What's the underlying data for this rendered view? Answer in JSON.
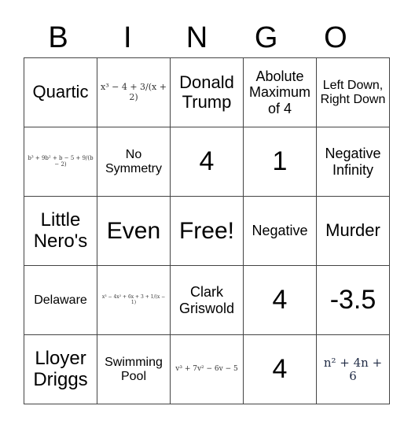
{
  "header": [
    "B",
    "I",
    "N",
    "G",
    "O"
  ],
  "cells": [
    [
      "Quartic",
      "x³ − 4 + 3/(x + 2)",
      "Donald Trump",
      "Abolute Maximum of 4",
      "Left Down, Right Down"
    ],
    [
      "b³ + 9b² + b − 5 + 9/(b − 2)",
      "No Symmetry",
      "4",
      "1",
      "Negative Infinity"
    ],
    [
      "Little Nero's",
      "Even",
      "Free!",
      "Negative",
      "Murder"
    ],
    [
      "Delaware",
      "x³ − 4x² + 6x + 3 + 1/(x − 1)",
      "Clark Griswold",
      "4",
      "-3.5"
    ],
    [
      "Lloyer Driggs",
      "Swimming Pool",
      "v³ + 7v² − 6v − 5",
      "4",
      "n² + 4n + 6"
    ]
  ]
}
